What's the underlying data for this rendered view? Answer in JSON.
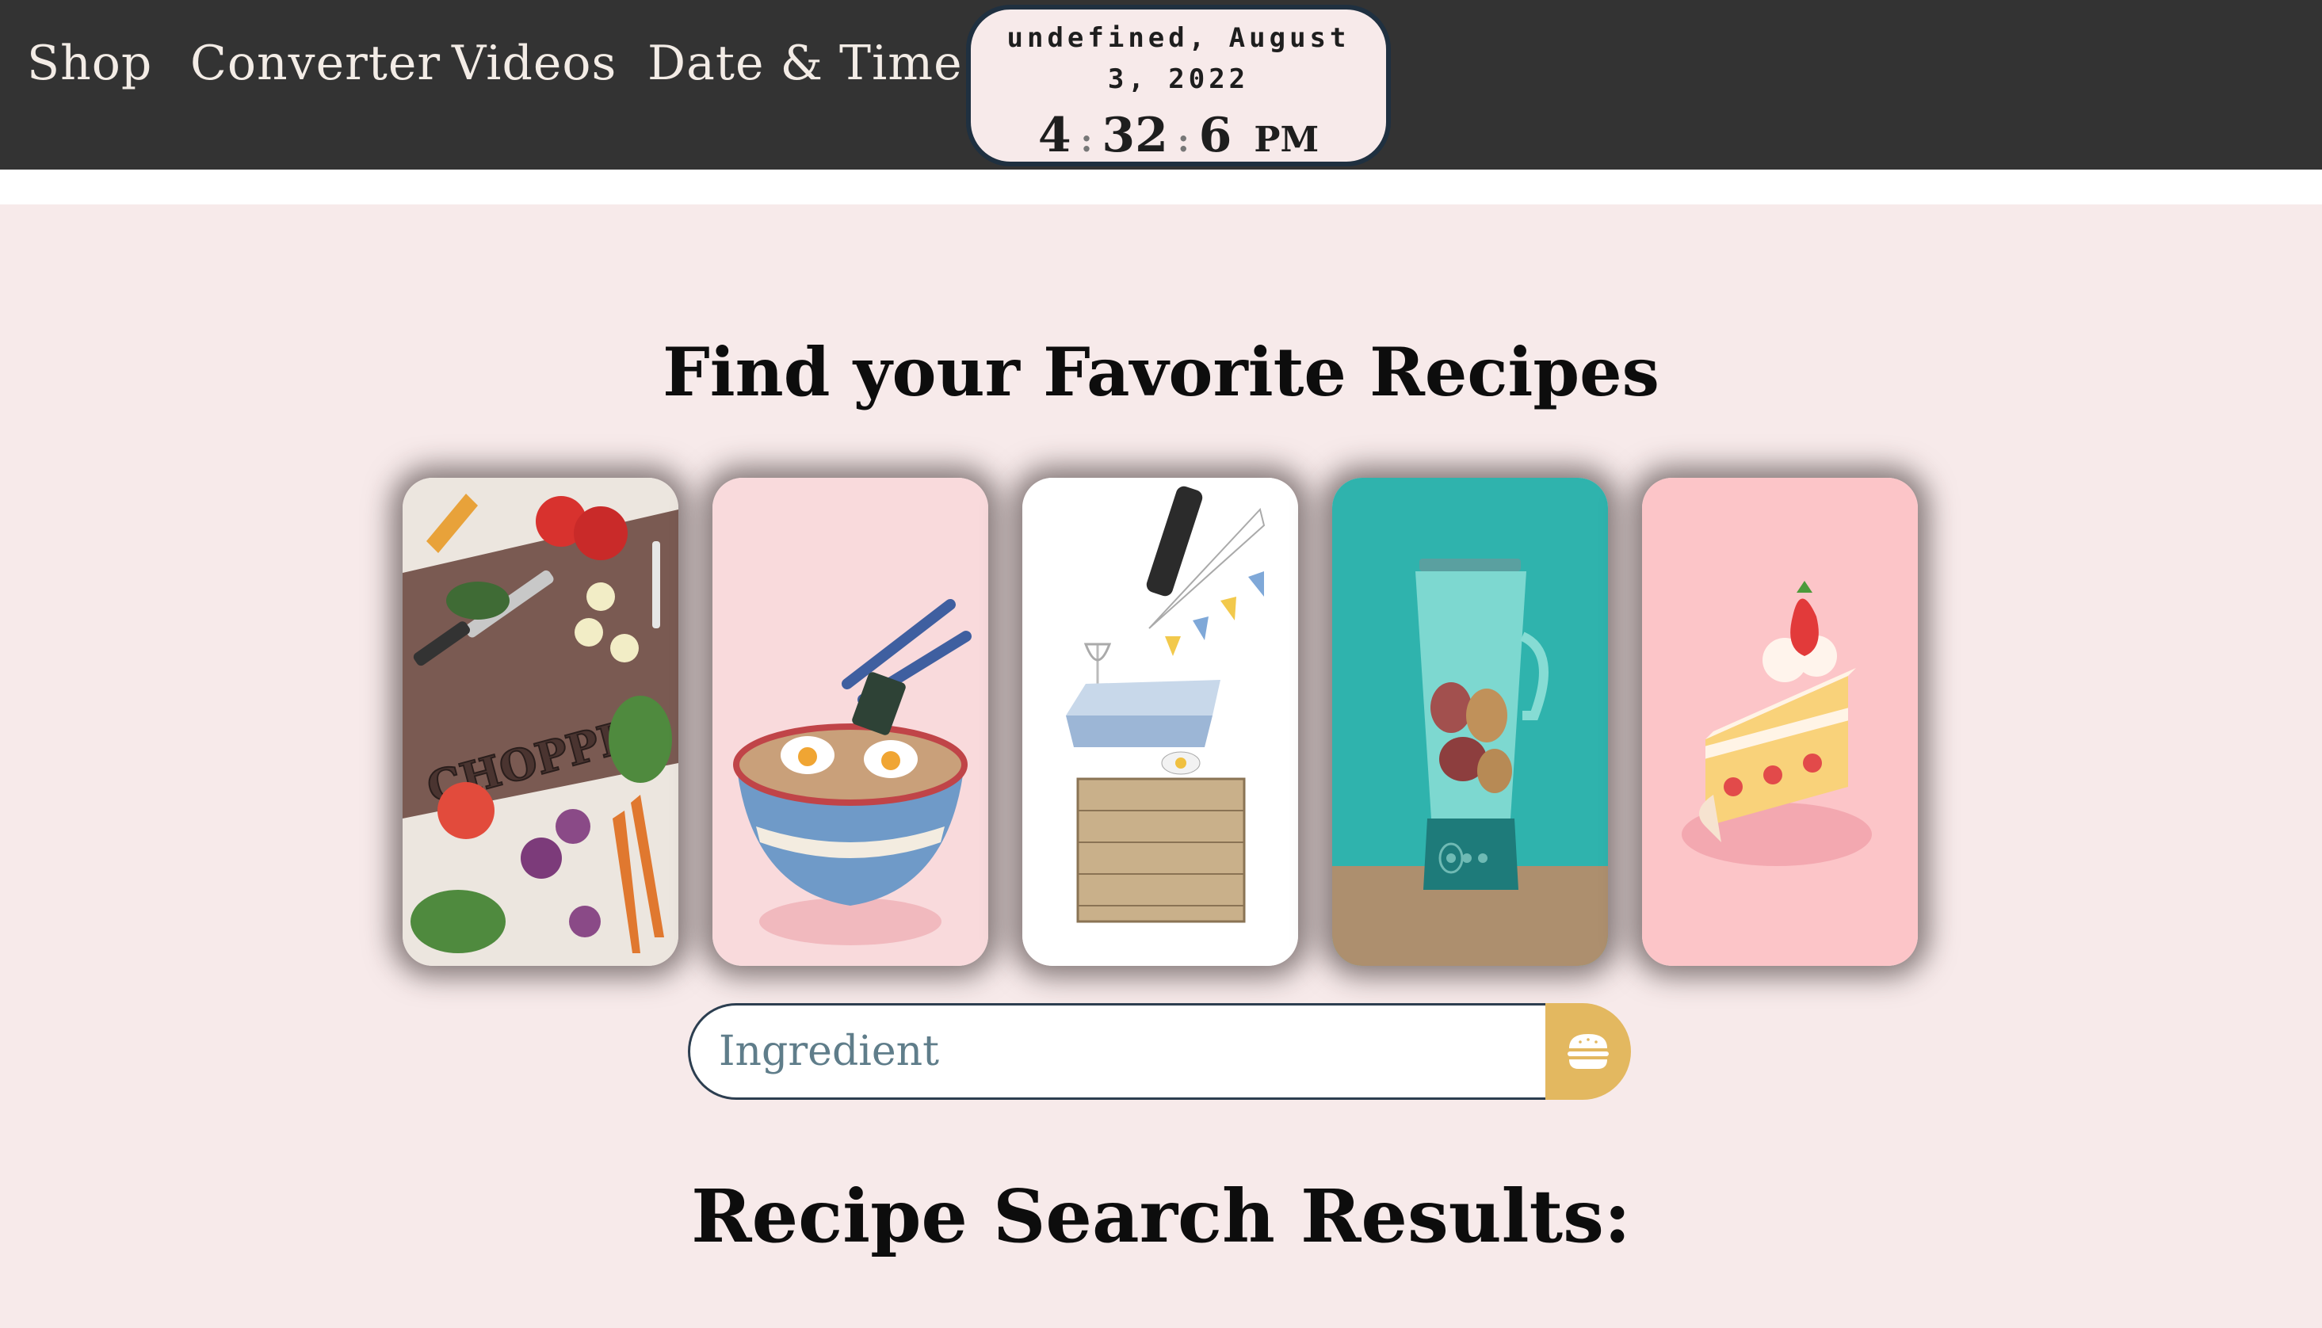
{
  "nav": {
    "items": [
      {
        "label": "Shop"
      },
      {
        "label": "Converter"
      },
      {
        "label": "Videos"
      },
      {
        "label": "Date & Time"
      }
    ]
  },
  "clock": {
    "date": "undefined, August 3, 2022",
    "hours": "4",
    "separator": ":",
    "minutes": "32",
    "seconds": "6",
    "period": "PM"
  },
  "main": {
    "title": "Find your Favorite Recipes",
    "cards": [
      {
        "name": "chopped-vegetables",
        "text": "CHOPPED",
        "bg": "#7a5a52"
      },
      {
        "name": "ramen-bowl",
        "bg": "#f9dadc"
      },
      {
        "name": "picnic-basket",
        "bg": "#ffffff"
      },
      {
        "name": "blender-smoothie",
        "bg": "#2fb3ad"
      },
      {
        "name": "strawberry-cake",
        "bg": "#fcc5c8"
      }
    ],
    "search": {
      "placeholder": "Ingredient",
      "button_icon": "hamburger-icon"
    },
    "results_title": "Recipe Search Results:"
  },
  "colors": {
    "navbar": "#333333",
    "page_bg": "#f7eaea",
    "clock_border": "#1f3040",
    "search_button": "#e3b860"
  }
}
